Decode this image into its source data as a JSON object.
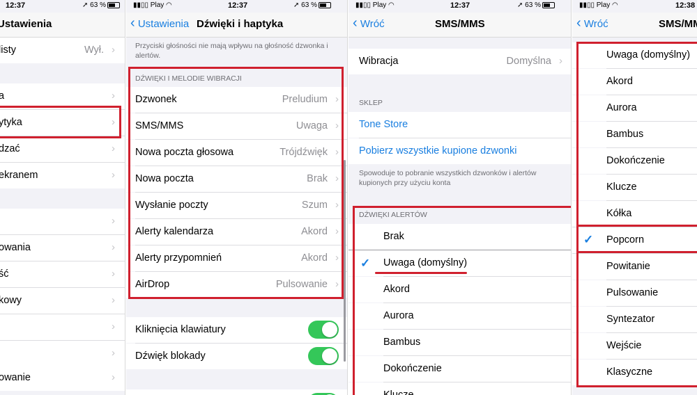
{
  "panel1": {
    "status": {
      "time": "12:37",
      "battery": "63 %"
    },
    "nav_title": "Ustawienia",
    "rows": [
      {
        "label": "listy",
        "value": "Wył."
      },
      {
        "label": "a"
      },
      {
        "label": "ytyka"
      },
      {
        "label": "dzać"
      },
      {
        "label": "ekranem"
      },
      {
        "label": ""
      },
      {
        "label": "owania"
      },
      {
        "label": "ść"
      },
      {
        "label": "kowy"
      },
      {
        "label": ""
      },
      {
        "label": ""
      },
      {
        "label": "owanie"
      }
    ]
  },
  "panel2": {
    "status": {
      "carrier": "Play",
      "time": "12:37",
      "battery": "63 %"
    },
    "back_label": "Ustawienia",
    "nav_title": "Dźwięki i haptyka",
    "note": "Przyciski głośności nie mają wpływu na głośność dzwonka i alertów.",
    "section_header": "DŹWIĘKI I MELODIE WIBRACJI",
    "rows": [
      {
        "label": "Dzwonek",
        "value": "Preludium"
      },
      {
        "label": "SMS/MMS",
        "value": "Uwaga"
      },
      {
        "label": "Nowa poczta głosowa",
        "value": "Trójdźwięk"
      },
      {
        "label": "Nowa poczta",
        "value": "Brak"
      },
      {
        "label": "Wysłanie poczty",
        "value": "Szum"
      },
      {
        "label": "Alerty kalendarza",
        "value": "Akord"
      },
      {
        "label": "Alerty przypomnień",
        "value": "Akord"
      },
      {
        "label": "AirDrop",
        "value": "Pulsowanie"
      }
    ],
    "toggles": [
      {
        "label": "Kliknięcia klawiatury",
        "on": true
      },
      {
        "label": "Dźwięk blokady",
        "on": true
      }
    ]
  },
  "panel3": {
    "status": {
      "carrier": "Play",
      "time": "12:37",
      "battery": "63 %"
    },
    "back_label": "Wróć",
    "nav_title": "SMS/MMS",
    "vibration": {
      "label": "Wibracja",
      "value": "Domyślna"
    },
    "store_header": "SKLEP",
    "tone_store": "Tone Store",
    "download_all": "Pobierz wszystkie kupione dzwonki",
    "store_note": "Spowoduje to pobranie wszystkich dzwonków i alertów kupionych przy użyciu konta",
    "alerts_header": "DŹWIĘKI ALERTÓW",
    "alerts": [
      "Brak",
      "Uwaga (domyślny)",
      "Akord",
      "Aurora",
      "Bambus",
      "Dokończenie",
      "Klucze"
    ],
    "selected": "Uwaga (domyślny)"
  },
  "panel4": {
    "status": {
      "carrier": "Play",
      "time": "12:38"
    },
    "back_label": "Wróć",
    "nav_title": "SMS/MMS",
    "alerts": [
      "Uwaga (domyślny)",
      "Akord",
      "Aurora",
      "Bambus",
      "Dokończenie",
      "Klucze",
      "Kółka",
      "Popcorn",
      "Powitanie",
      "Pulsowanie",
      "Syntezator",
      "Wejście",
      "Klasyczne"
    ],
    "selected": "Popcorn"
  },
  "colors": {
    "accent": "#1a7fe0",
    "highlight": "#d0202e",
    "toggle_on": "#34c759"
  }
}
